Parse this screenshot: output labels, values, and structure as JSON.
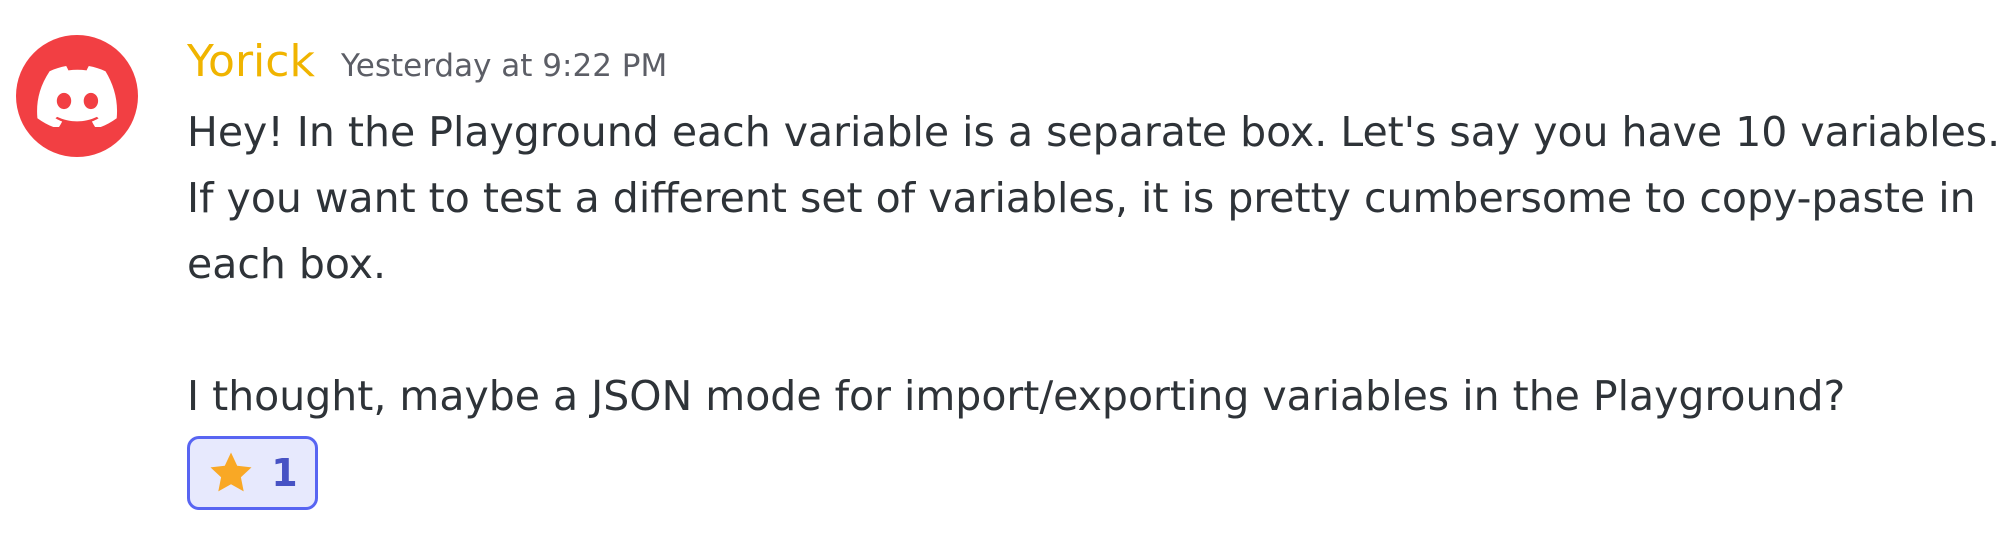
{
  "message": {
    "author": "Yorick",
    "timestamp": "Yesterday at 9:22 PM",
    "lines": [
      "Hey! In the Playground each variable is a separate box. Let's say you have 10 variables.",
      "If you want to test a different set of variables, it is pretty cumbersome to copy-paste in",
      "each box.",
      "I thought, maybe a JSON mode for import/exporting variables in the Playground?"
    ]
  },
  "avatar": {
    "icon": "discord-logo-icon",
    "background": "#f23f43"
  },
  "reactions": [
    {
      "emoji": "star-icon",
      "count": "1"
    }
  ],
  "colors": {
    "author": "#f0b400",
    "timestamp": "#5c5e66",
    "text": "#2e3338",
    "reaction_border": "#5865f2",
    "reaction_bg": "#e7e9fd",
    "reaction_count": "#4752c4",
    "star": "#f9a825"
  }
}
